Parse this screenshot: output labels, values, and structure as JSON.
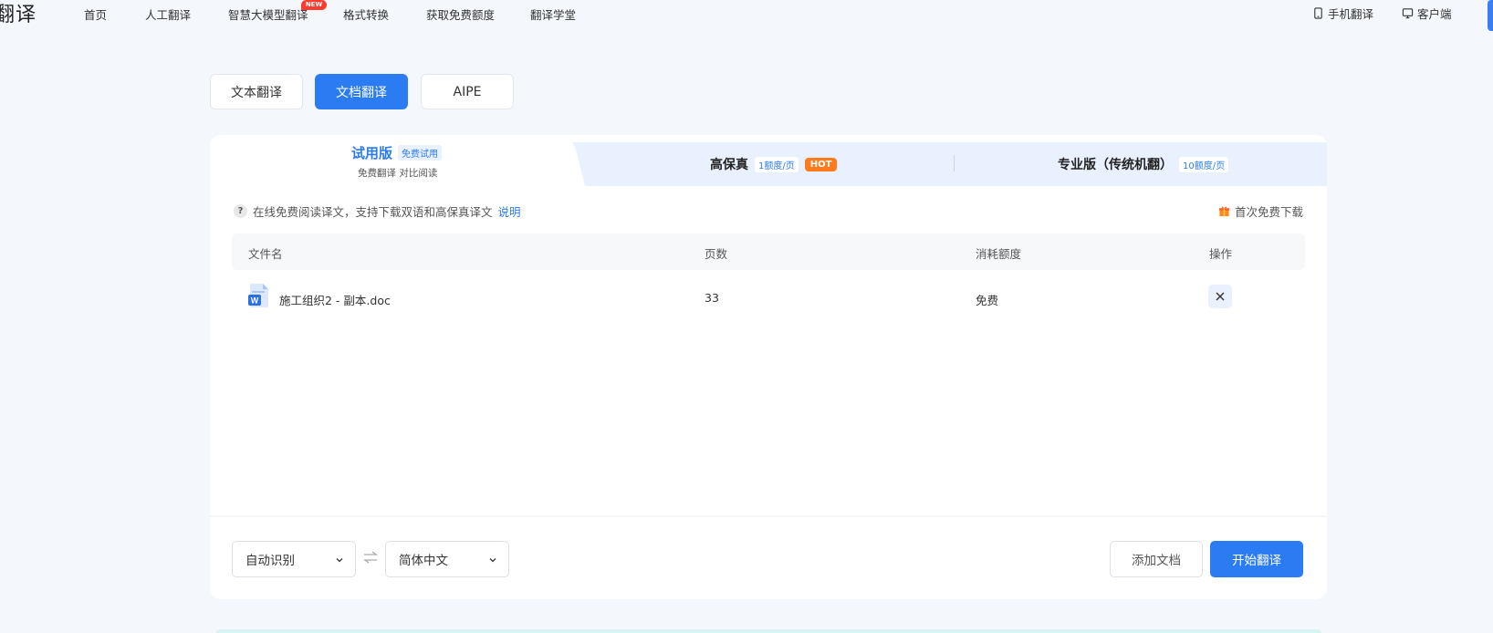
{
  "brand": {
    "logo_text": "翻译"
  },
  "nav": {
    "items": [
      {
        "label": "首页"
      },
      {
        "label": "人工翻译"
      },
      {
        "label": "智慧大模型翻译"
      },
      {
        "label": "格式转换"
      },
      {
        "label": "获取免费额度"
      },
      {
        "label": "翻译学堂"
      }
    ],
    "new_badge": "NEW",
    "mobile_label": "手机翻译",
    "client_label": "客户端"
  },
  "mode_tabs": [
    {
      "label": "文本翻译",
      "active": false
    },
    {
      "label": "文档翻译",
      "active": true
    },
    {
      "label": "AIPE",
      "active": false
    }
  ],
  "tiers": {
    "trial": {
      "title": "试用版",
      "badge": "免费试用",
      "subtitle": "免费翻译 对比阅读"
    },
    "hifi": {
      "title": "高保真",
      "badge": "1额度/页",
      "hot": "HOT"
    },
    "pro": {
      "title": "专业版（传统机翻）",
      "badge": "10额度/页"
    }
  },
  "notice": {
    "text": "在线免费阅读译文，支持下载双语和高保真译文",
    "link": "说明"
  },
  "gift": {
    "label": "首次免费下载"
  },
  "table": {
    "headers": [
      "文件名",
      "页数",
      "消耗额度",
      "操作"
    ],
    "rows": [
      {
        "file_name": "施工组织2 - 副本.doc",
        "pages": "33",
        "cost": "免费"
      }
    ]
  },
  "footer": {
    "source_lang": "自动识别",
    "target_lang": "简体中文",
    "add_doc": "添加文档",
    "start": "开始翻译"
  },
  "colors": {
    "accent": "#2b7cf2",
    "hot": "#ff7a1a",
    "new": "#ff3b30"
  },
  "icons": [
    "phone-icon",
    "monitor-icon",
    "question-icon",
    "gift-icon",
    "word-file-icon",
    "close-icon",
    "chevron-down-icon",
    "swap-icon"
  ]
}
